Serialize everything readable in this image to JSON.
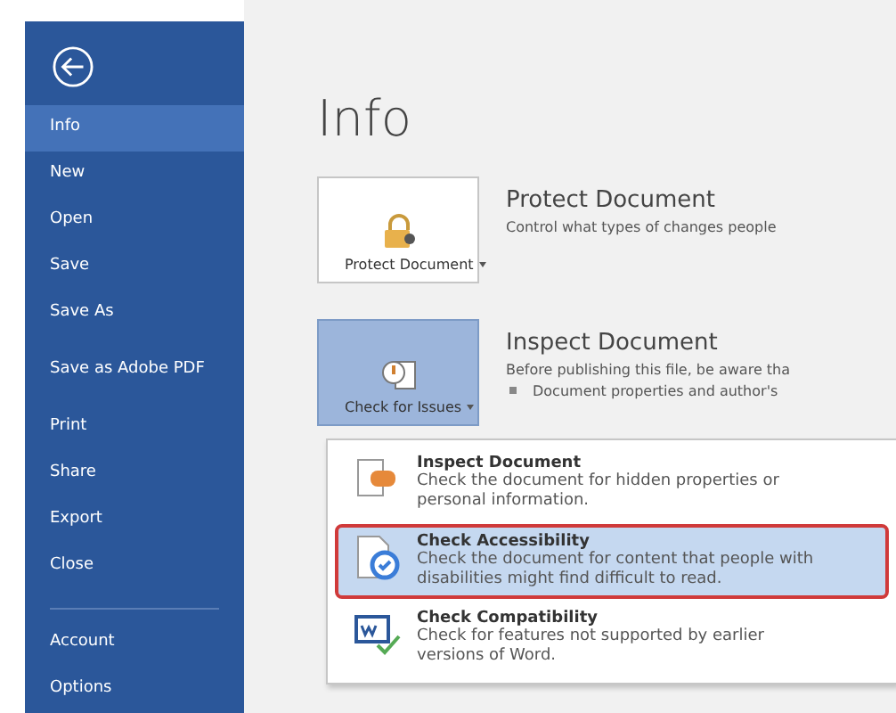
{
  "sidebar": {
    "items": [
      {
        "label": "Info",
        "selected": true
      },
      {
        "label": "New",
        "selected": false
      },
      {
        "label": "Open",
        "selected": false
      },
      {
        "label": "Save",
        "selected": false
      },
      {
        "label": "Save As",
        "selected": false
      },
      {
        "label": "Save as Adobe PDF",
        "selected": false
      },
      {
        "label": "Print",
        "selected": false
      },
      {
        "label": "Share",
        "selected": false
      },
      {
        "label": "Export",
        "selected": false
      },
      {
        "label": "Close",
        "selected": false
      }
    ],
    "bottom_items": [
      {
        "label": "Account",
        "selected": false
      },
      {
        "label": "Options",
        "selected": false
      }
    ]
  },
  "title": "Info",
  "sections": [
    {
      "kind": "protect",
      "button": "Protect Document",
      "pressed": false,
      "heading": "Protect Document",
      "lines": [
        "Control what types of changes people"
      ]
    },
    {
      "kind": "inspect",
      "button": "Check for Issues",
      "pressed": true,
      "heading": "Inspect Document",
      "lines": [
        "Before publishing this file, be aware tha"
      ],
      "bullets": [
        "Document properties and author's"
      ]
    }
  ],
  "menu": {
    "items": [
      {
        "kind": "inspect",
        "title": "Inspect Document",
        "description": "Check the document for hidden properties or personal information.",
        "selected": false
      },
      {
        "kind": "accessibility",
        "title": "Check Accessibility",
        "description": "Check the document for content that people with disabilities might find difficult to read.",
        "selected": true
      },
      {
        "kind": "compatibility",
        "title": "Check Compatibility",
        "description": "Check for features not supported by earlier versions of Word.",
        "selected": false
      }
    ]
  }
}
